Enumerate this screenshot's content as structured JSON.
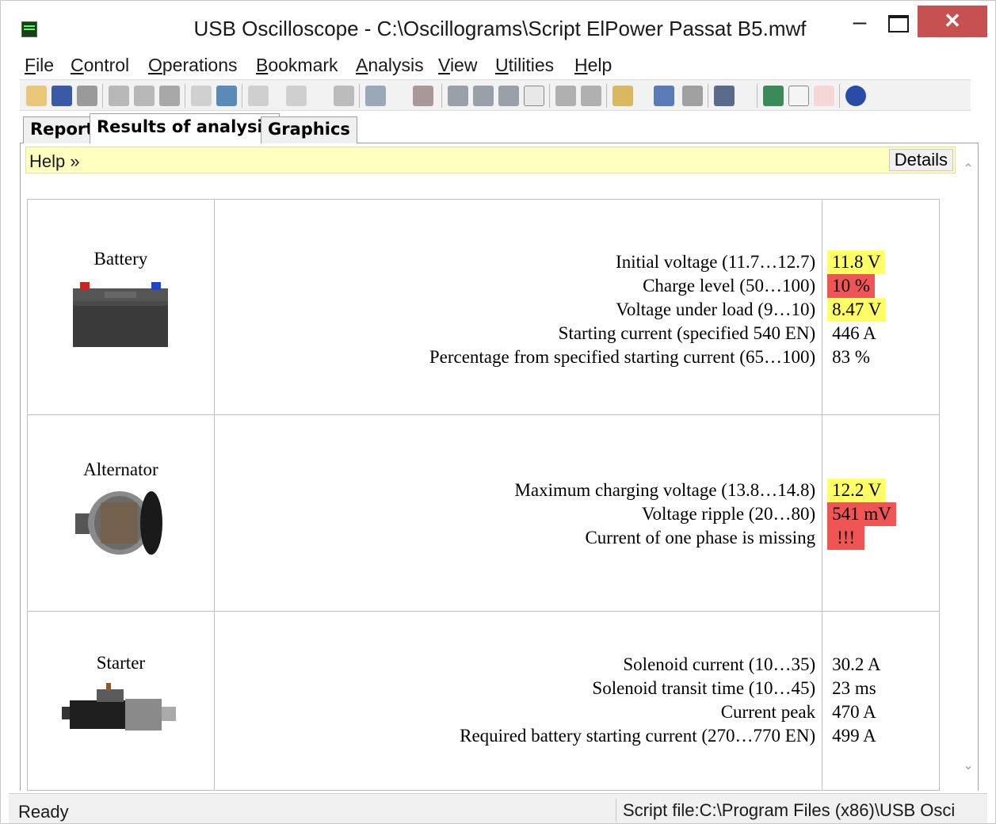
{
  "window": {
    "title": "USB Oscilloscope - C:\\Oscillograms\\Script ElPower Passat B5.mwf",
    "minimize": "–",
    "close": "✕"
  },
  "menu": {
    "items": [
      {
        "u": "F",
        "rest": "ile"
      },
      {
        "u": "C",
        "rest": "ontrol"
      },
      {
        "u": "O",
        "rest": "perations"
      },
      {
        "u": "B",
        "rest": "ookmark"
      },
      {
        "u": "A",
        "rest": "nalysis"
      },
      {
        "u": "V",
        "rest": "iew"
      },
      {
        "u": "U",
        "rest": "tilities"
      },
      {
        "u": "H",
        "rest": "elp"
      }
    ]
  },
  "tabs": [
    "Report",
    "Results of analysis",
    "Graphics"
  ],
  "helpbar": {
    "help": "Help »",
    "details": "Details"
  },
  "report": {
    "battery": {
      "name": "Battery",
      "params": [
        "Initial voltage (11.7…12.7)",
        "Charge level (50…100)",
        "Voltage under load (9…10)",
        "Starting current (specified 540 EN)",
        "Percentage from specified starting current (65…100)"
      ],
      "values": [
        "11.8 V",
        "10 %",
        "8.47 V",
        "446 A",
        "83 %"
      ]
    },
    "alternator": {
      "name": "Alternator",
      "params": [
        "Maximum charging voltage (13.8…14.8)",
        "Voltage ripple (20…80)",
        "Current of one phase is missing"
      ],
      "values": [
        "12.2 V",
        "541 mV",
        "!!!"
      ]
    },
    "starter": {
      "name": "Starter",
      "params": [
        "Solenoid current (10…35)",
        "Solenoid transit time (10…45)",
        "Current peak",
        "Required battery starting current (270…770 EN)"
      ],
      "values": [
        "30.2 A",
        "23 ms",
        "470 A",
        "499 A"
      ]
    }
  },
  "statusbar": {
    "left": "Ready",
    "right": "Script file:C:\\Program Files (x86)\\USB Osci"
  },
  "colors": {
    "warn": "#ffff66",
    "bad": "#f05555",
    "help_bg": "#ffffc0",
    "close_btn": "#c75050"
  }
}
